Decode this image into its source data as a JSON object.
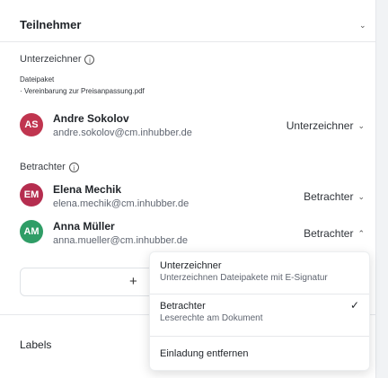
{
  "header": {
    "title": "Teilnehmer"
  },
  "signers": {
    "section_label": "Unterzeichner",
    "package_label": "Dateipaket",
    "package_item": "Vereinbarung zur Preisanpassung.pdf",
    "people": [
      {
        "initials": "AS",
        "name": "Andre Sokolov",
        "email": "andre.sokolov@cm.inhubber.de",
        "role": "Unterzeichner",
        "color": "#c0354f"
      }
    ]
  },
  "viewers": {
    "section_label": "Betrachter",
    "people": [
      {
        "initials": "EM",
        "name": "Elena Mechik",
        "email": "elena.mechik@cm.inhubber.de",
        "role": "Betrachter",
        "color": "#b52d4f"
      },
      {
        "initials": "AM",
        "name": "Anna Müller",
        "email": "anna.mueller@cm.inhubber.de",
        "role": "Betrachter",
        "color": "#2f9d66"
      }
    ]
  },
  "add": {
    "icon": "+"
  },
  "labels": {
    "title": "Labels"
  },
  "menu": {
    "items": [
      {
        "title": "Unterzeichner",
        "subtitle": "Unterzeichnen Dateipakete mit E-Signatur"
      },
      {
        "title": "Betrachter",
        "subtitle": "Leserechte am Dokument",
        "selected": true
      },
      {
        "title": "Einladung entfernen"
      }
    ]
  },
  "colors": {
    "accent": "#1f2328"
  }
}
